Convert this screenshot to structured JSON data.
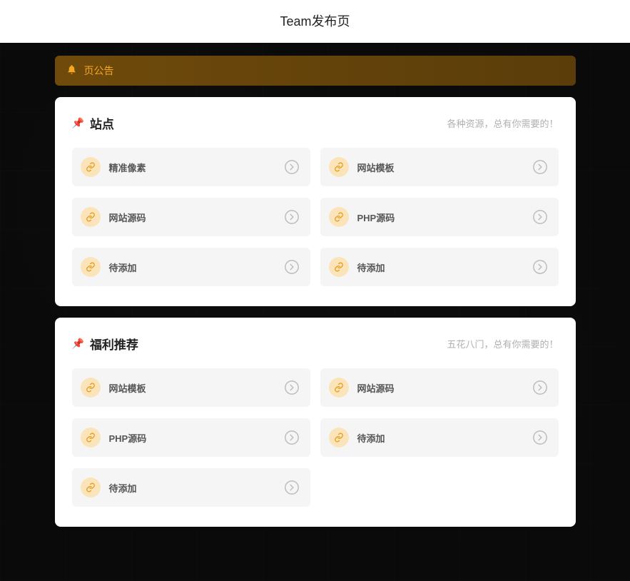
{
  "header": {
    "title": "Team发布页"
  },
  "notice": {
    "text": "页公告"
  },
  "sections": [
    {
      "title": "站点",
      "subtitle": "各种资源，总有你需要的！",
      "items": [
        {
          "label": "精准像素"
        },
        {
          "label": "网站模板"
        },
        {
          "label": "网站源码"
        },
        {
          "label": "PHP源码"
        },
        {
          "label": "待添加"
        },
        {
          "label": "待添加"
        }
      ]
    },
    {
      "title": "福利推荐",
      "subtitle": "五花八门，总有你需要的！",
      "items": [
        {
          "label": "网站模板"
        },
        {
          "label": "网站源码"
        },
        {
          "label": "PHP源码"
        },
        {
          "label": "待添加"
        },
        {
          "label": "待添加"
        }
      ]
    }
  ]
}
